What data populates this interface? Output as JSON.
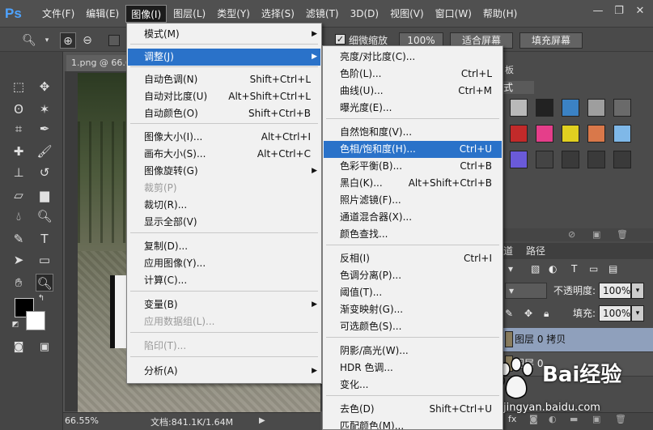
{
  "app": {
    "logo": "Ps"
  },
  "menubar": {
    "items": [
      "文件(F)",
      "编辑(E)",
      "图像(I)",
      "图层(L)",
      "类型(Y)",
      "选择(S)",
      "滤镜(T)",
      "3D(D)",
      "视图(V)",
      "窗口(W)",
      "帮助(H)"
    ],
    "active_index": 2,
    "window_controls": [
      "minimize-icon",
      "restore-icon",
      "close-icon"
    ]
  },
  "options": {
    "scrubby_zoom_checked": true,
    "scrubby_zoom_label": "细微缩放",
    "zoom_100": "100%",
    "fit_screen": "适合屏幕",
    "fill_screen": "填充屏幕"
  },
  "document": {
    "tab_title": "1.png @ 66.6"
  },
  "status": {
    "zoom": "66.55%",
    "doc_size": "文档:841.1K/1.64M"
  },
  "image_menu": {
    "items": [
      {
        "label": "模式(M)",
        "shortcut": "",
        "submenu": true,
        "disabled": false
      },
      {
        "label": "调整(J)",
        "shortcut": "",
        "submenu": true,
        "disabled": false,
        "highlighted": true
      },
      {
        "label": "自动色调(N)",
        "shortcut": "Shift+Ctrl+L",
        "submenu": false,
        "disabled": false
      },
      {
        "label": "自动对比度(U)",
        "shortcut": "Alt+Shift+Ctrl+L",
        "submenu": false,
        "disabled": false
      },
      {
        "label": "自动颜色(O)",
        "shortcut": "Shift+Ctrl+B",
        "submenu": false,
        "disabled": false
      },
      {
        "label": "图像大小(I)...",
        "shortcut": "Alt+Ctrl+I",
        "submenu": false,
        "disabled": false
      },
      {
        "label": "画布大小(S)...",
        "shortcut": "Alt+Ctrl+C",
        "submenu": false,
        "disabled": false
      },
      {
        "label": "图像旋转(G)",
        "shortcut": "",
        "submenu": true,
        "disabled": false
      },
      {
        "label": "裁剪(P)",
        "shortcut": "",
        "submenu": false,
        "disabled": true
      },
      {
        "label": "裁切(R)...",
        "shortcut": "",
        "submenu": false,
        "disabled": false
      },
      {
        "label": "显示全部(V)",
        "shortcut": "",
        "submenu": false,
        "disabled": false
      },
      {
        "label": "复制(D)...",
        "shortcut": "",
        "submenu": false,
        "disabled": false
      },
      {
        "label": "应用图像(Y)...",
        "shortcut": "",
        "submenu": false,
        "disabled": false
      },
      {
        "label": "计算(C)...",
        "shortcut": "",
        "submenu": false,
        "disabled": false
      },
      {
        "label": "变量(B)",
        "shortcut": "",
        "submenu": true,
        "disabled": false
      },
      {
        "label": "应用数据组(L)...",
        "shortcut": "",
        "submenu": false,
        "disabled": true
      },
      {
        "label": "陷印(T)...",
        "shortcut": "",
        "submenu": false,
        "disabled": true
      },
      {
        "label": "分析(A)",
        "shortcut": "",
        "submenu": true,
        "disabled": false
      }
    ]
  },
  "adjust_menu": {
    "items": [
      {
        "label": "亮度/对比度(C)...",
        "shortcut": ""
      },
      {
        "label": "色阶(L)...",
        "shortcut": "Ctrl+L"
      },
      {
        "label": "曲线(U)...",
        "shortcut": "Ctrl+M"
      },
      {
        "label": "曝光度(E)...",
        "shortcut": ""
      },
      {
        "label": "自然饱和度(V)...",
        "shortcut": ""
      },
      {
        "label": "色相/饱和度(H)...",
        "shortcut": "Ctrl+U",
        "highlighted": true
      },
      {
        "label": "色彩平衡(B)...",
        "shortcut": "Ctrl+B"
      },
      {
        "label": "黑白(K)...",
        "shortcut": "Alt+Shift+Ctrl+B"
      },
      {
        "label": "照片滤镜(F)...",
        "shortcut": ""
      },
      {
        "label": "通道混合器(X)...",
        "shortcut": ""
      },
      {
        "label": "颜色查找...",
        "shortcut": ""
      },
      {
        "label": "反相(I)",
        "shortcut": "Ctrl+I"
      },
      {
        "label": "色调分离(P)...",
        "shortcut": ""
      },
      {
        "label": "阈值(T)...",
        "shortcut": ""
      },
      {
        "label": "渐变映射(G)...",
        "shortcut": ""
      },
      {
        "label": "可选颜色(S)...",
        "shortcut": ""
      },
      {
        "label": "阴影/高光(W)...",
        "shortcut": ""
      },
      {
        "label": "HDR 色调...",
        "shortcut": ""
      },
      {
        "label": "变化...",
        "shortcut": ""
      },
      {
        "label": "去色(D)",
        "shortcut": "Shift+Ctrl+U"
      },
      {
        "label": "匹配颜色(M)...",
        "shortcut": ""
      }
    ]
  },
  "panels": {
    "styles_tab_partial": "板",
    "styles_label": "式",
    "swatch_colors": [
      "#b9b9b9",
      "#222222",
      "#3b82c4",
      "#9e9e9e",
      "#6a6a6a",
      "#c22a2a",
      "#e53e8a",
      "#e0d020",
      "#d9784a",
      "#7fb8e8",
      "#6a5ad9",
      "#444444",
      "#3a3a3a",
      "#3a3a3a",
      "#3a3a3a"
    ],
    "layers_tabs": [
      "道",
      "路径"
    ],
    "opacity_label": "不透明度:",
    "opacity_value": "100%",
    "fill_label": "填充:",
    "fill_value": "100%",
    "layers": [
      {
        "name": "图层 0 拷贝",
        "selected": true
      },
      {
        "name": "图层 0",
        "selected": false
      }
    ]
  },
  "watermark": {
    "brand": "Bai",
    "text": "经验",
    "url": "jingyan.baidu.com"
  }
}
